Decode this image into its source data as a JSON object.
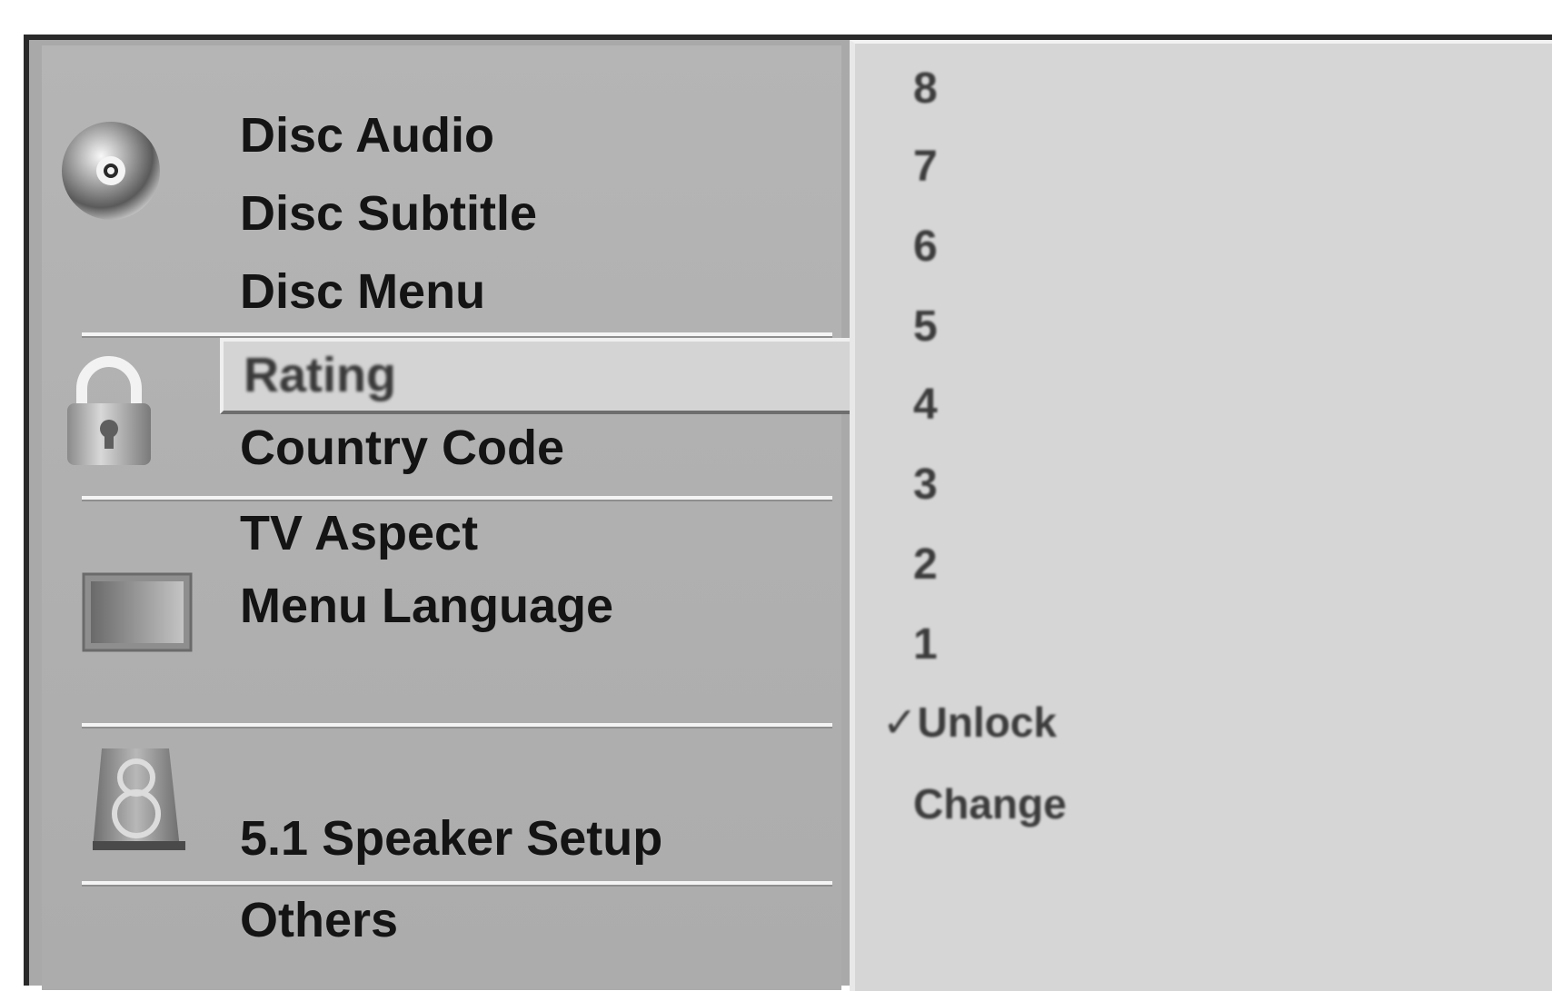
{
  "setup_menu": {
    "language_group": {
      "icon": "disc-icon",
      "items": [
        "Disc Audio",
        "Disc Subtitle",
        "Disc Menu"
      ]
    },
    "lock_group": {
      "icon": "padlock-icon",
      "items": [
        "Rating",
        "Country Code"
      ],
      "selected": "Rating"
    },
    "display_group": {
      "icon": "tv-screen-icon",
      "items": [
        "TV Aspect",
        "Menu Language"
      ]
    },
    "audio_group": {
      "icon": "speaker-icon",
      "items": [
        "5.1 Speaker Setup"
      ]
    },
    "others_group": {
      "items": [
        "Others"
      ]
    }
  },
  "rating_options": {
    "levels": [
      "8",
      "7",
      "6",
      "5",
      "4",
      "3",
      "2",
      "1"
    ],
    "unlock": "✓Unlock",
    "change": "Change"
  },
  "colors": {
    "panel_background": "#b0b0b0",
    "options_background": "#d6d6d6",
    "highlight_background": "#d4d4d4",
    "text": "#141414"
  }
}
